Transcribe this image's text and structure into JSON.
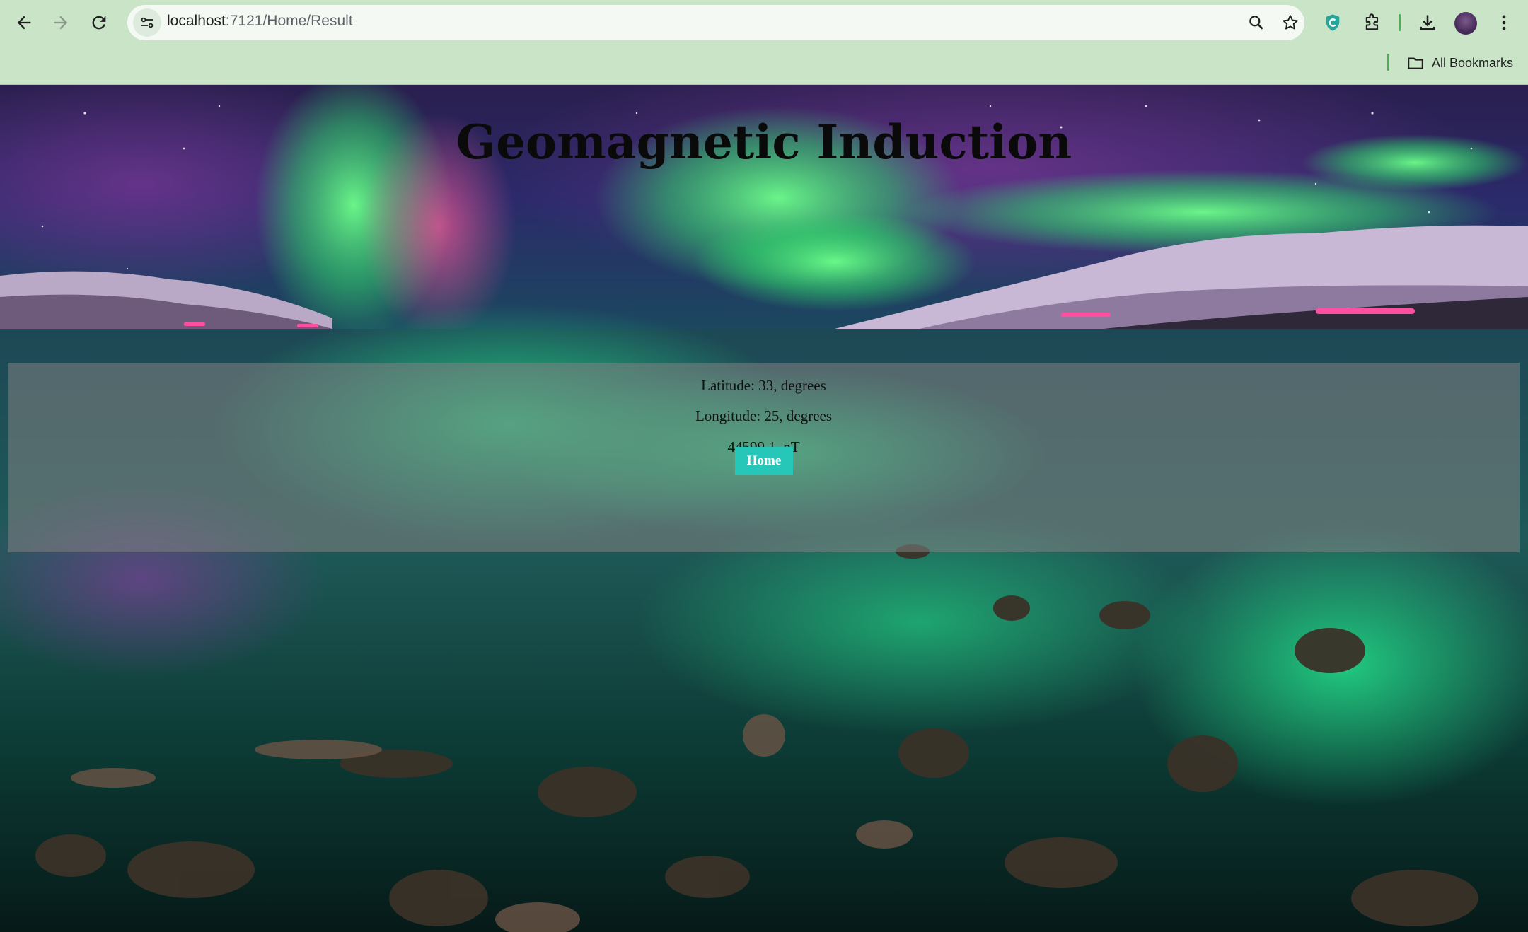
{
  "browser": {
    "url_host": "localhost",
    "url_path": ":7121/Home/Result",
    "bookmarks_label": "All Bookmarks",
    "icons": [
      "back-icon",
      "forward-icon",
      "reload-icon",
      "site-info-icon",
      "zoom-icon",
      "star-icon",
      "extension-shield-icon",
      "extensions-puzzle-icon",
      "download-icon",
      "avatar",
      "menu-kebab-icon",
      "folder-icon"
    ]
  },
  "page": {
    "title": "Geomagnetic Induction",
    "latitude": "Latitude: 33, degrees",
    "longitude": "Longitude: 25, degrees",
    "result": "44599.1, nT",
    "home_button": "Home",
    "colors": {
      "button": "#26c6b8",
      "panel": "rgba(130,130,130,0.55)"
    }
  }
}
